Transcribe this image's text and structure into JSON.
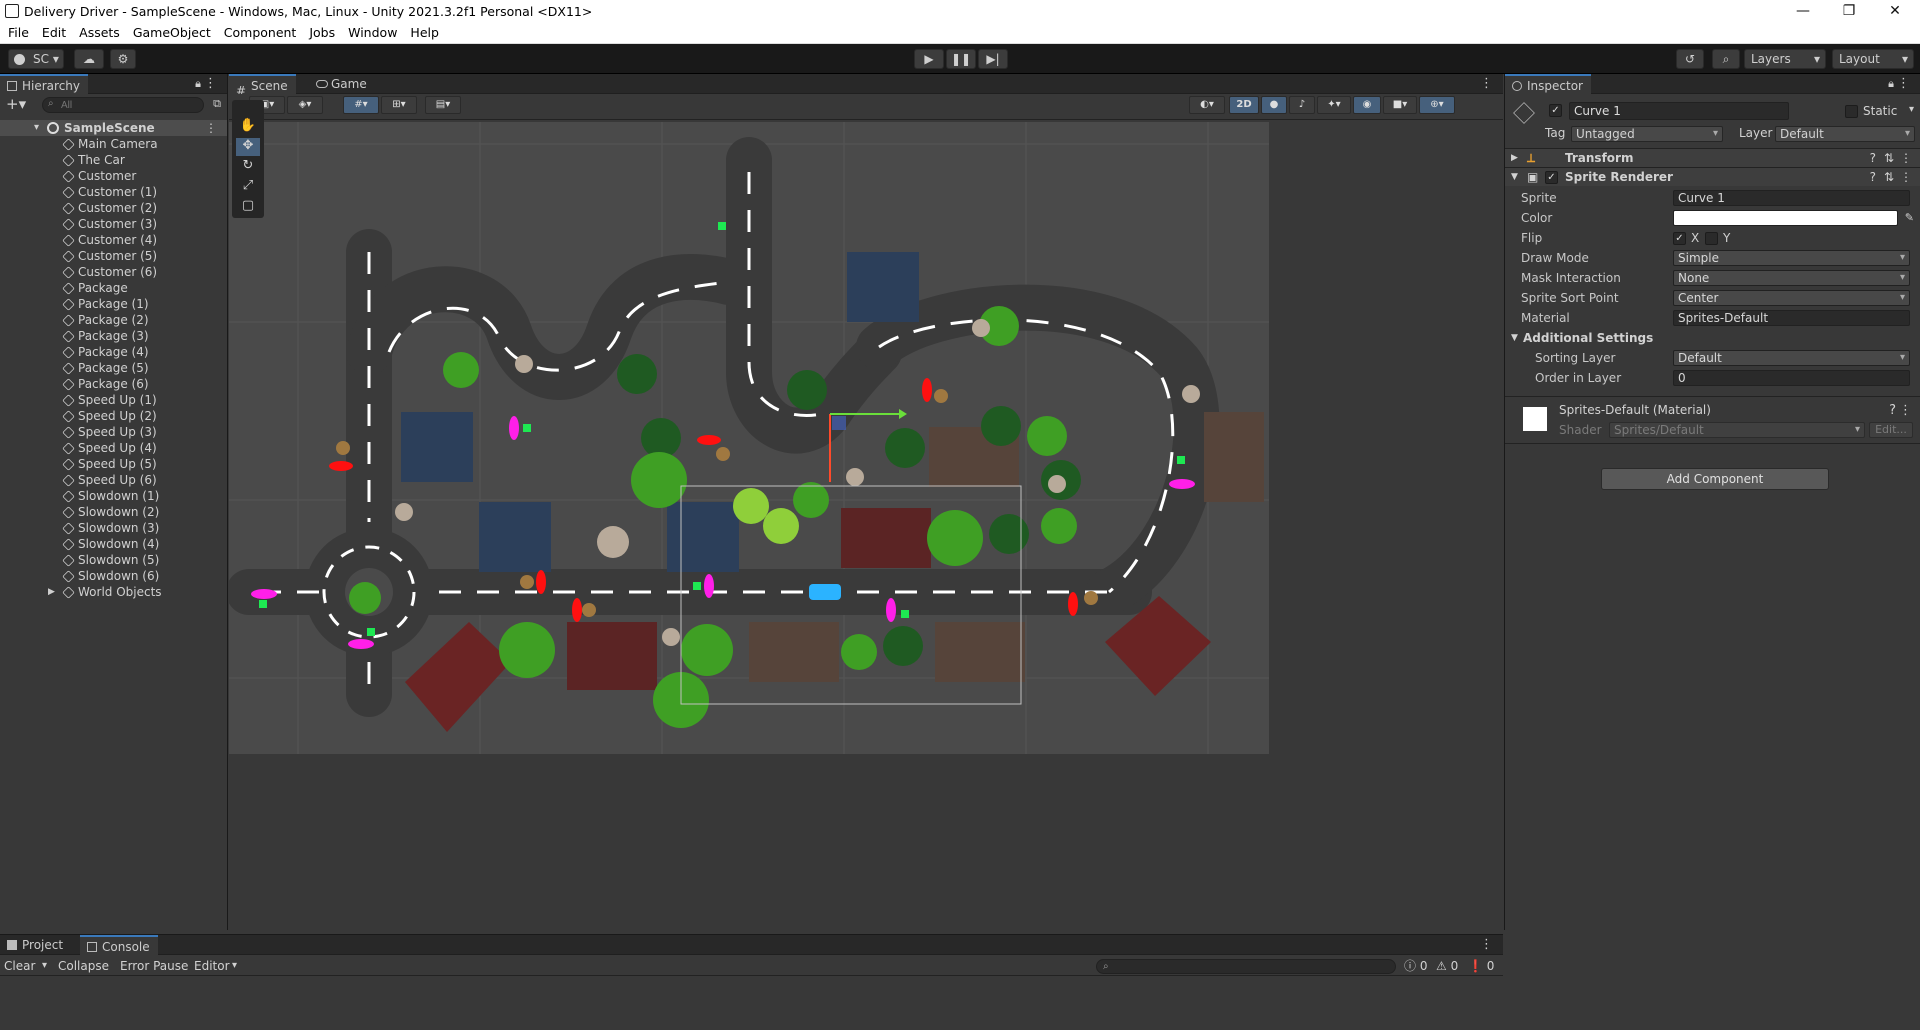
{
  "window": {
    "title": "Delivery Driver - SampleScene - Windows, Mac, Linux - Unity 2021.3.2f1 Personal <DX11>",
    "minimize": "—",
    "maximize": "❐",
    "close": "✕"
  },
  "menu": [
    "File",
    "Edit",
    "Assets",
    "GameObject",
    "Component",
    "Jobs",
    "Window",
    "Help"
  ],
  "toolbar": {
    "account": "SC",
    "layers": "Layers",
    "layout": "Layout"
  },
  "hierarchy": {
    "tab": "Hierarchy",
    "search_placeholder": "All",
    "scene": "SampleScene",
    "items": [
      "Main Camera",
      "The Car",
      "Customer",
      "Customer (1)",
      "Customer (2)",
      "Customer (3)",
      "Customer (4)",
      "Customer (5)",
      "Customer (6)",
      "Package",
      "Package (1)",
      "Package (2)",
      "Package (3)",
      "Package (4)",
      "Package (5)",
      "Package (6)",
      "Speed Up (1)",
      "Speed Up (2)",
      "Speed Up (3)",
      "Speed Up (4)",
      "Speed Up (5)",
      "Speed Up (6)",
      "Slowdown (1)",
      "Slowdown (2)",
      "Slowdown (3)",
      "Slowdown (4)",
      "Slowdown (5)",
      "Slowdown (6)",
      "World Objects"
    ]
  },
  "scene_tabs": {
    "scene": "Scene",
    "game": "Game",
    "mode_2d": "2D"
  },
  "inspector": {
    "tab": "Inspector",
    "object_name": "Curve 1",
    "static_label": "Static",
    "tag_label": "Tag",
    "tag_value": "Untagged",
    "layer_label": "Layer",
    "layer_value": "Default",
    "transform": "Transform",
    "sprite_renderer": "Sprite Renderer",
    "props": [
      {
        "k": "Sprite",
        "v": "Curve 1"
      },
      {
        "k": "Color",
        "v": ""
      },
      {
        "k": "Flip",
        "v": ""
      },
      {
        "k": "Draw Mode",
        "v": "Simple"
      },
      {
        "k": "Mask Interaction",
        "v": "None"
      },
      {
        "k": "Sprite Sort Point",
        "v": "Center"
      },
      {
        "k": "Material",
        "v": "Sprites-Default"
      }
    ],
    "flip_x": "X",
    "flip_y": "Y",
    "additional_settings": "Additional Settings",
    "sorting_layer_label": "Sorting Layer",
    "sorting_layer_value": "Default",
    "order_label": "Order in Layer",
    "order_value": "0",
    "material_name": "Sprites-Default (Material)",
    "shader_label": "Shader",
    "shader_value": "Sprites/Default",
    "edit_label": "Edit...",
    "add_component": "Add Component"
  },
  "console": {
    "project_tab": "Project",
    "console_tab": "Console",
    "clear": "Clear",
    "collapse": "Collapse",
    "error_pause": "Error Pause",
    "editor": "Editor",
    "count_info": "0",
    "count_warn": "0",
    "count_err": "0"
  }
}
